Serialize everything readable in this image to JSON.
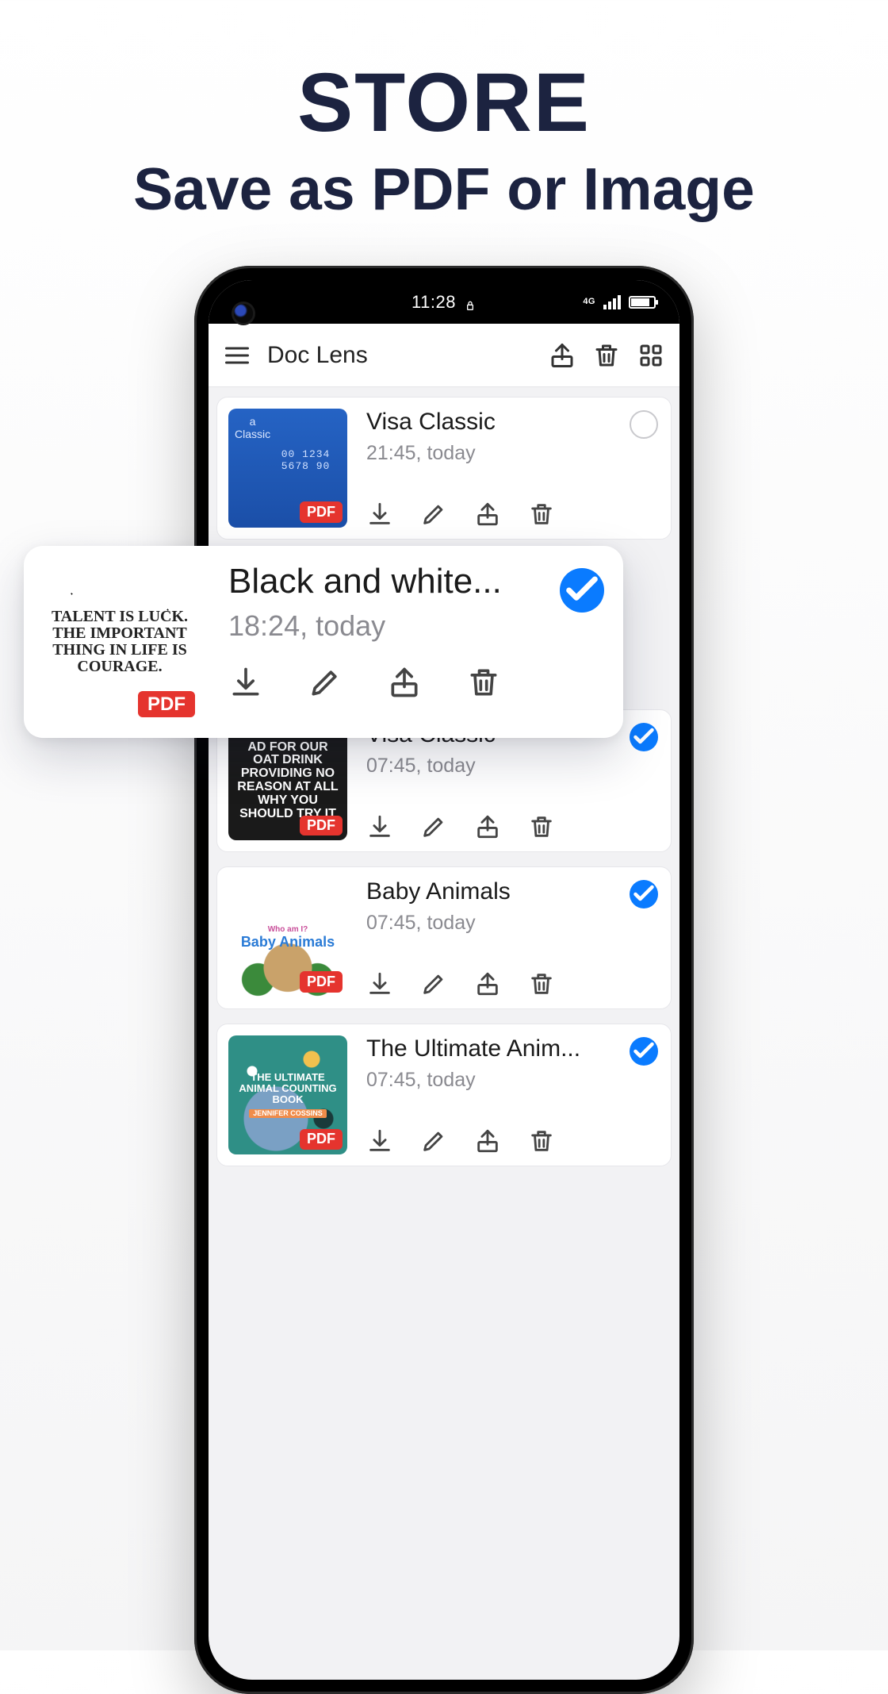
{
  "hero": {
    "title": "STORE",
    "subtitle": "Save as PDF or Image"
  },
  "status": {
    "time": "11:28"
  },
  "app": {
    "title": "Doc Lens"
  },
  "badge": {
    "pdf": "PDF"
  },
  "docs": [
    {
      "title": "Visa Classic",
      "time": "21:45, today",
      "selected": false,
      "thumb_label": "a Classic",
      "thumb_cardno": "00 1234 5678 90"
    },
    {
      "title": "Black and white...",
      "time": "18:24, today",
      "selected": true,
      "thumb_text": "TALENT IS LUCK. THE IMPORTANT THING IN LIFE IS COURAGE."
    },
    {
      "title": "Visa Classic",
      "time": "07:45, today",
      "selected": true,
      "thumb_text": "AD FOR OUR OAT DRINK PROVIDING NO REASON AT ALL WHY YOU SHOULD TRY IT"
    },
    {
      "title": "Baby Animals",
      "time": "07:45, today",
      "selected": true,
      "thumb_who": "Who am I?",
      "thumb_text": "Baby Animals"
    },
    {
      "title": "The Ultimate Anim...",
      "time": "07:45, today",
      "selected": true,
      "thumb_text": "THE ULTIMATE ANIMAL COUNTING BOOK",
      "thumb_author": "JENNIFER COSSINS"
    }
  ]
}
